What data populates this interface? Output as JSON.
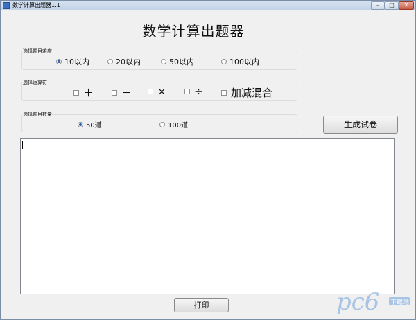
{
  "window": {
    "title": "数学计算出题器1.1"
  },
  "heading": "数学计算出题器",
  "difficulty": {
    "label": "选择题目难度",
    "options": [
      {
        "label": "10以内",
        "checked": true
      },
      {
        "label": "20以内",
        "checked": false
      },
      {
        "label": "50以内",
        "checked": false
      },
      {
        "label": "100以内",
        "checked": false
      }
    ]
  },
  "operators": {
    "label": "选择运算符",
    "options": [
      {
        "label": "＋",
        "checked": false
      },
      {
        "label": "－",
        "checked": false
      },
      {
        "label": "×",
        "checked": false
      },
      {
        "label": "÷",
        "checked": false
      },
      {
        "label": "加减混合",
        "checked": false
      }
    ]
  },
  "count": {
    "label": "选择题目数量",
    "options": [
      {
        "label": "50道",
        "checked": true
      },
      {
        "label": "100道",
        "checked": false
      }
    ]
  },
  "buttons": {
    "generate": "生成试卷",
    "print": "打印"
  },
  "output": {
    "value": ""
  },
  "watermark": {
    "text": "pc6",
    "sub": "下载站"
  },
  "colors": {
    "accent": "#2a5db0",
    "watermark": "#8fb6e0"
  }
}
